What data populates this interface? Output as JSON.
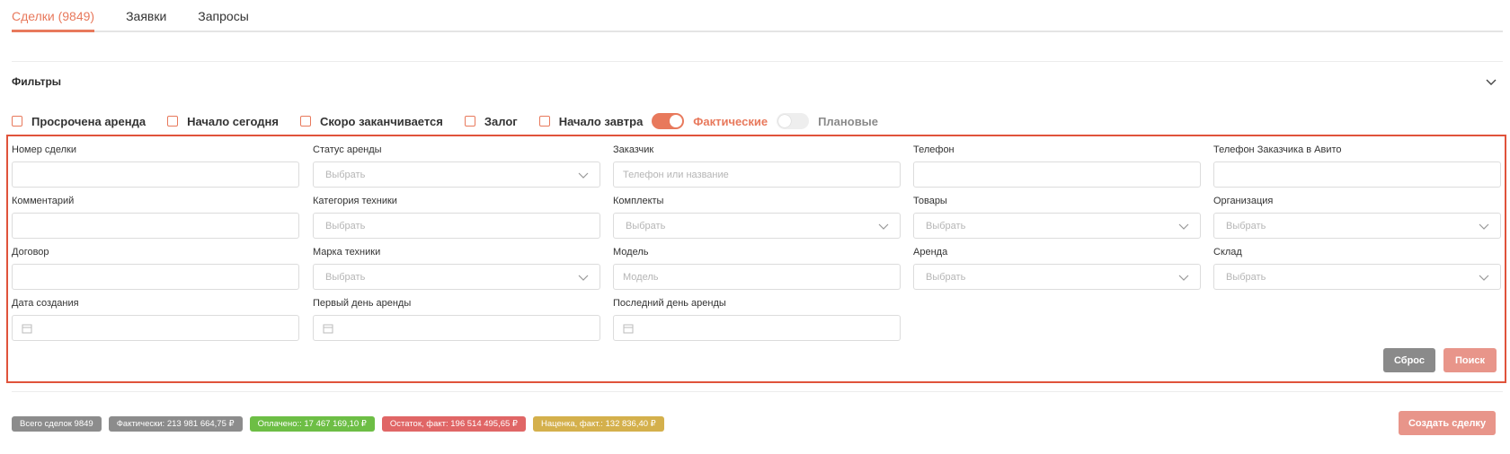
{
  "tabs": [
    {
      "label": "Сделки (9849)",
      "active": true
    },
    {
      "label": "Заявки",
      "active": false
    },
    {
      "label": "Запросы",
      "active": false
    }
  ],
  "filters": {
    "title": "Фильтры"
  },
  "quick_filters": [
    {
      "label": "Просрочена аренда"
    },
    {
      "label": "Начало сегодня"
    },
    {
      "label": "Скоро заканчивается"
    },
    {
      "label": "Залог"
    },
    {
      "label": "Начало завтра"
    }
  ],
  "toggles": [
    {
      "label": "Фактические",
      "on": true
    },
    {
      "label": "Плановые",
      "on": false
    }
  ],
  "fields": {
    "deal_number": {
      "label": "Номер сделки",
      "value": ""
    },
    "rent_status": {
      "label": "Статус аренды",
      "placeholder": "Выбрать"
    },
    "customer": {
      "label": "Заказчик",
      "placeholder": "Телефон или название"
    },
    "phone": {
      "label": "Телефон",
      "value": ""
    },
    "avito_phone": {
      "label": "Телефон Заказчика в Авито",
      "value": ""
    },
    "comment": {
      "label": "Комментарий",
      "value": ""
    },
    "equipment_category": {
      "label": "Категория техники",
      "placeholder": "Выбрать"
    },
    "kits": {
      "label": "Комплекты",
      "placeholder": "Выбрать"
    },
    "goods": {
      "label": "Товары",
      "placeholder": "Выбрать"
    },
    "organization": {
      "label": "Организация",
      "placeholder": "Выбрать"
    },
    "contract": {
      "label": "Договор",
      "value": ""
    },
    "brand": {
      "label": "Марка техники",
      "placeholder": "Выбрать"
    },
    "model": {
      "label": "Модель",
      "placeholder": "Модель"
    },
    "rent": {
      "label": "Аренда",
      "placeholder": "Выбрать"
    },
    "warehouse": {
      "label": "Склад",
      "placeholder": "Выбрать"
    },
    "created_date": {
      "label": "Дата создания",
      "value": ""
    },
    "first_day": {
      "label": "Первый день аренды",
      "value": ""
    },
    "last_day": {
      "label": "Последний день аренды",
      "value": ""
    }
  },
  "buttons": {
    "reset": "Сброс",
    "search": "Поиск",
    "create_deal": "Создать сделку"
  },
  "stats": [
    {
      "label": "Всего сделок 9849",
      "color": "#8c8c8c"
    },
    {
      "label": "Фактически: 213 981 664,75 ₽",
      "color": "#8c8c8c"
    },
    {
      "label": "Оплачено:: 17 467 169,10 ₽",
      "color": "#6dbe45"
    },
    {
      "label": "Остаток, факт: 196 514 495,65 ₽",
      "color": "#e06666"
    },
    {
      "label": "Наценка, факт.: 132 836,40 ₽",
      "color": "#d4b04c"
    }
  ],
  "colors": {
    "accent": "#e8795c",
    "form_border": "#e0533b",
    "reset": "#8a8a8a",
    "search": "#e8958a",
    "create": "#e8958a"
  }
}
